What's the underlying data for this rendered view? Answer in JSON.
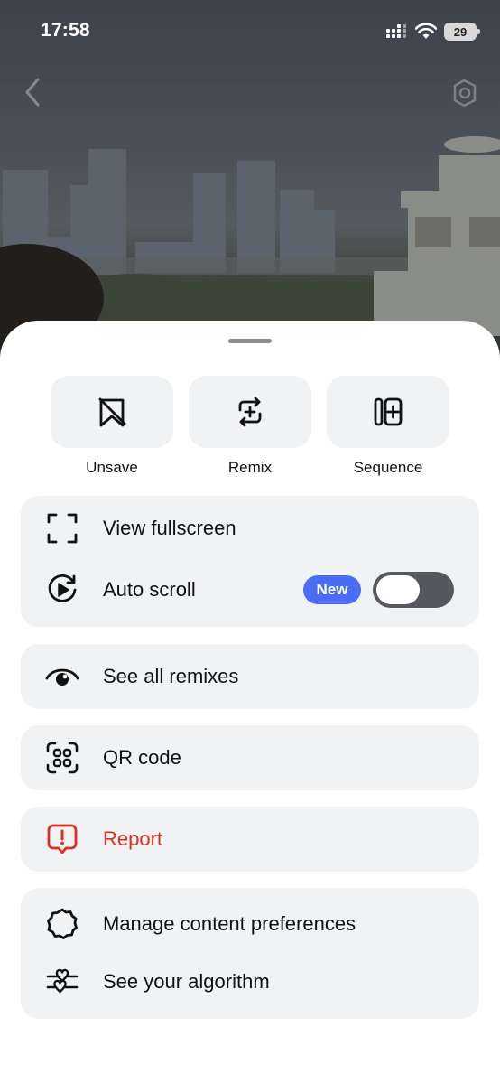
{
  "status_bar": {
    "time": "17:58",
    "battery": "29"
  },
  "quick_actions": [
    {
      "label": "Unsave",
      "icon": "unsave-icon"
    },
    {
      "label": "Remix",
      "icon": "remix-icon"
    },
    {
      "label": "Sequence",
      "icon": "sequence-icon"
    }
  ],
  "menu": {
    "view_fullscreen": "View fullscreen",
    "auto_scroll": "Auto scroll",
    "new_badge": "New",
    "auto_scroll_enabled": false,
    "see_all_remixes": "See all remixes",
    "qr_code": "QR code",
    "report": "Report",
    "manage_content_preferences": "Manage content preferences",
    "see_your_algorithm": "See your algorithm"
  },
  "colors": {
    "accent": "#4a6cf7",
    "danger": "#d93025",
    "tile": "#f1f2f4",
    "toggle_off": "#55595e"
  }
}
